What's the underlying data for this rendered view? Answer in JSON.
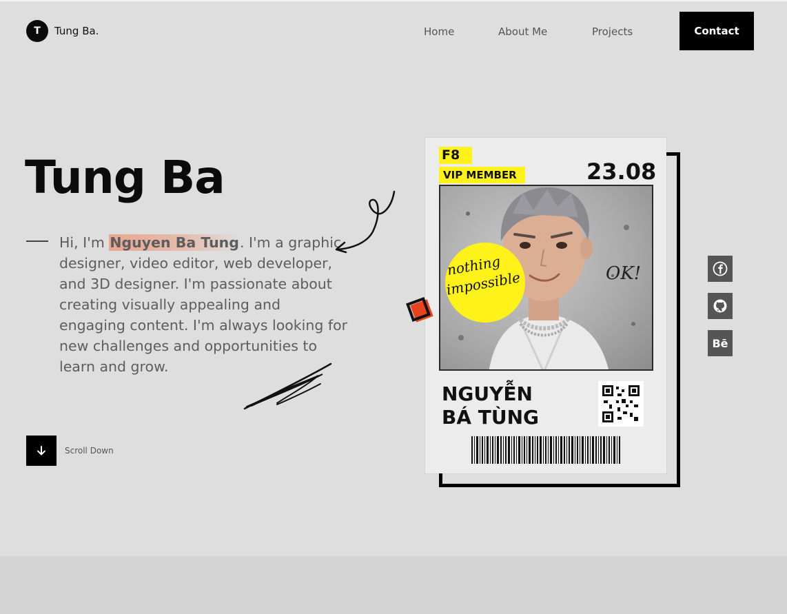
{
  "header": {
    "logo_letter": "T",
    "logo_text": "Tung Ba.",
    "nav": {
      "home": "Home",
      "about": "About Me",
      "projects": "Projects"
    },
    "contact_label": "Contact"
  },
  "hero": {
    "title": "Tung Ba",
    "intro_prefix": "Hi, I'm ",
    "intro_name": "Nguyen Ba Tung",
    "intro_rest": ". I'm a graphic designer, video editor, web developer, and 3D designer. I'm passionate about creating visually appealing and engaging content. I'm always looking for new challenges and opportunities to learn and grow.",
    "scroll_label": "Scroll Down"
  },
  "card": {
    "badge": "F8",
    "member": "VIP MEMBER",
    "date": "23.08",
    "sticker_line1": "nothing",
    "sticker_line2": "impossible",
    "ok_text": "OK!",
    "name_line1": "NGUYỄN",
    "name_line2": "BÁ TÙNG"
  },
  "social": {
    "behance": "Bē"
  },
  "icons": [
    "arrow-down-icon",
    "facebook-icon",
    "github-icon",
    "behance-icon",
    "qr-code-icon",
    "barcode-icon"
  ],
  "colors": {
    "background": "#dedede",
    "accent_yellow": "#fff11a",
    "highlight": "#f0825a",
    "square": "#e8431f"
  }
}
